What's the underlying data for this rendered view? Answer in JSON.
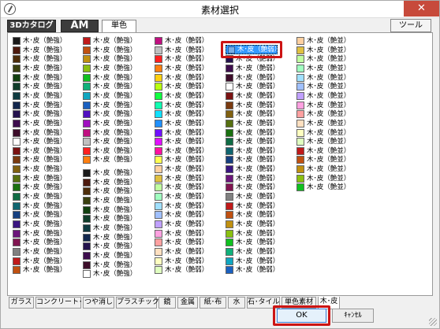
{
  "window": {
    "title": "素材選択",
    "close_glyph": "✕"
  },
  "top_tabs": {
    "catalog": "3Dカタログ",
    "am": "AM",
    "single": "単色",
    "tool": "ツール"
  },
  "columns": [
    {
      "label": "木･皮（艶強）",
      "colors": [
        "#1a1a1a",
        "#4d1a0e",
        "#4d2d0a",
        "#3a4010",
        "#114010",
        "#0f3d2a",
        "#0e3a40",
        "#12274d",
        "#24124d",
        "#3d0d4d",
        "#3d0d2a",
        "#ffffff",
        "#7a1212",
        "#7a3a10",
        "#806010",
        "#567010",
        "#1a7010",
        "#0f6b44",
        "#0f6570",
        "#163f80",
        "#3a1580",
        "#6b157a",
        "#801550",
        "#808080",
        "#c01a1a",
        "#c05010",
        "#c09010",
        "#8ac010",
        "#10c020",
        "#10b07a",
        "#10a6c0",
        "#1a60c0",
        "#5010c0",
        "#a010c0",
        "#c01080",
        "#c0c0c0",
        "#ff2020",
        "#ff7f10",
        "#ffd010",
        "#b8ff10",
        "#10ff40",
        "#10ffb0",
        "#10e0ff",
        "#2090ff",
        "#7010ff",
        "#e010ff",
        "#ff10a0",
        "#ffff50",
        "#ffe0a0",
        "#e0c040"
      ]
    },
    {
      "label": "木･皮（艶強）",
      "colors": []
    },
    {
      "label": "木･皮（艶弱）",
      "colors": []
    },
    {
      "label": "木･皮（艶弱）",
      "colors": []
    },
    {
      "label": "木･皮（艶並）",
      "colors": []
    }
  ],
  "selected_swatch": {
    "label": "木･皮（艶弱）",
    "color": "#7aaee6"
  },
  "bottom_tabs": [
    "ガラス",
    "コンクリート･土",
    "つや消し",
    "プラスチック",
    "鏡",
    "金属",
    "紙･布",
    "水",
    "石･タイル",
    "単色素材",
    "木･皮"
  ],
  "buttons": {
    "ok": "OK",
    "cancel": "ｷｬﾝｾﾙ"
  }
}
